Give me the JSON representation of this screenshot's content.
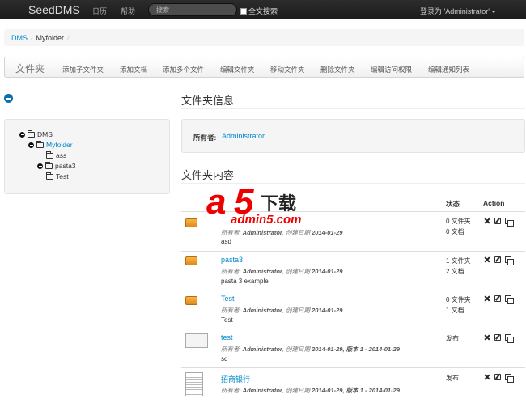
{
  "navbar": {
    "brand": "SeedDMS",
    "links": [
      "日历",
      "帮助"
    ],
    "search_placeholder": "搜索",
    "fulltext_label": "全文搜索",
    "user_label": "登录为 'Administrator'"
  },
  "breadcrumb": [
    "DMS",
    "Myfolder"
  ],
  "toolbar": {
    "title": "文件夹",
    "actions": [
      "添加子文件夹",
      "添加文档",
      "添加多个文件",
      "编辑文件夹",
      "移动文件夹",
      "删除文件夹",
      "编辑访问权限",
      "编辑通知列表"
    ]
  },
  "tree": {
    "root": "DMS",
    "folder": "Myfolder",
    "children": [
      "ass",
      "pasta3",
      "Test"
    ]
  },
  "folder_info": {
    "heading": "文件夹信息",
    "owner_label": "所有者:",
    "owner_value": "Administrator"
  },
  "content": {
    "heading": "文件夹内容",
    "col_status": "状态",
    "col_action": "Action",
    "rows": [
      {
        "name": "",
        "meta_owner": "所有者: ",
        "meta_owner_val": "Administrator",
        "meta_date": ", 创建日期 ",
        "meta_date_val": "2014-01-29",
        "meta_ver": "",
        "desc": "asd",
        "status1": "0 文件夹",
        "status2": "0 文档"
      },
      {
        "name": "pasta3",
        "meta_owner": "所有者: ",
        "meta_owner_val": "Administrator",
        "meta_date": ", 创建日期 ",
        "meta_date_val": "2014-01-29",
        "meta_ver": "",
        "desc": "pasta 3 example",
        "status1": "1 文件夹",
        "status2": "2 文档"
      },
      {
        "name": "Test",
        "meta_owner": "所有者: ",
        "meta_owner_val": "Administrator",
        "meta_date": ", 创建日期 ",
        "meta_date_val": "2014-01-29",
        "meta_ver": "",
        "desc": "Test",
        "status1": "0 文件夹",
        "status2": "1 文档"
      },
      {
        "name": "test",
        "meta_owner": "所有者: ",
        "meta_owner_val": "Administrator",
        "meta_date": ", 创建日期 ",
        "meta_date_val": "2014-01-29",
        "meta_ver": ", 版本 1 - 2014-01-29",
        "desc": "sd",
        "status1": "发布",
        "status2": ""
      },
      {
        "name": "招商银行",
        "meta_owner": "所有者: ",
        "meta_owner_val": "Administrator",
        "meta_date": ", 创建日期 ",
        "meta_date_val": "2014-01-29",
        "meta_ver": ", 版本 1 - 2014-01-29",
        "desc": "",
        "status1": "发布",
        "status2": ""
      }
    ]
  },
  "watermark": {
    "a": "a",
    "five": "5",
    "text": "下载",
    "url": "admin5.com"
  }
}
